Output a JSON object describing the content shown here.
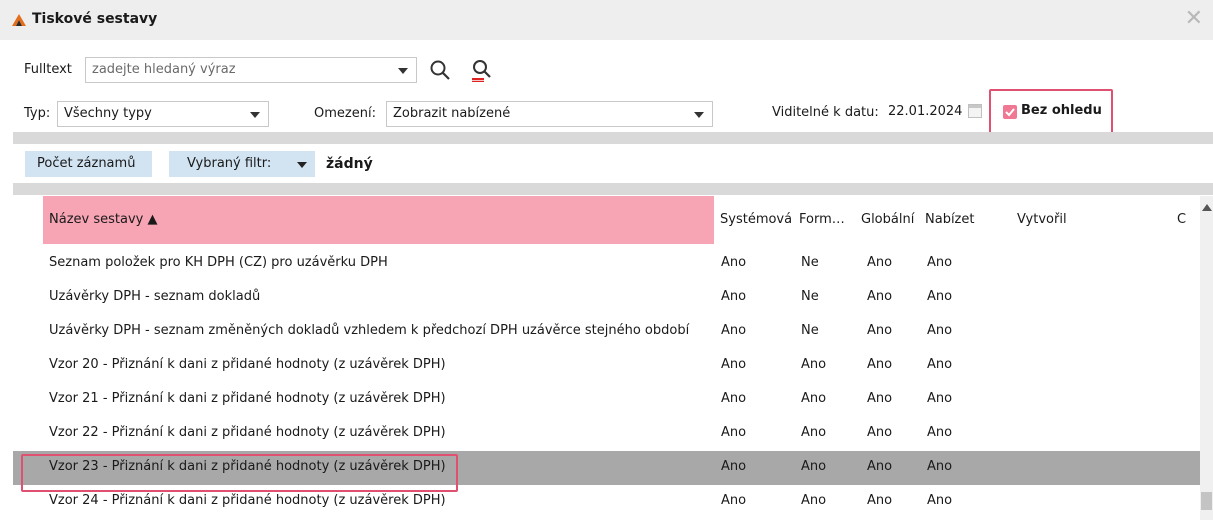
{
  "window": {
    "title": "Tiskové sestavy",
    "close_label": "✕"
  },
  "fulltext": {
    "label": "Fulltext",
    "placeholder": "zadejte hledaný výraz"
  },
  "filters": {
    "typ_label": "Typ:",
    "typ_value": "Všechny typy",
    "omezeni_label": "Omezení:",
    "omezeni_value": "Zobrazit nabízené",
    "date_label": "Viditelné k datu:",
    "date_value": "22.01.2024",
    "bez_ohledu_label": "Bez ohledu",
    "bez_ohledu_checked": true
  },
  "toolbar": {
    "count_label": "Počet záznamů",
    "filter_label": "Vybraný filtr:",
    "filter_value": "žádný"
  },
  "table": {
    "headers": [
      "Název sestavy ▲",
      "Systémová",
      "Form…",
      "Globální",
      "Nabízet",
      "Vytvořil",
      "C"
    ],
    "rows": [
      [
        "Seznam položek pro KH DPH (CZ) pro uzávěrku DPH",
        "Ano",
        "Ne",
        "Ano",
        "Ano"
      ],
      [
        "Uzávěrky DPH - seznam dokladů",
        "Ano",
        "Ne",
        "Ano",
        "Ano"
      ],
      [
        "Uzávěrky DPH - seznam změněných dokladů vzhledem k předchozí DPH uzávěrce stejného období",
        "Ano",
        "Ne",
        "Ano",
        "Ano"
      ],
      [
        "Vzor 20 - Přiznání k dani z přidané hodnoty (z uzávěrek DPH)",
        "Ano",
        "Ano",
        "Ano",
        "Ano"
      ],
      [
        "Vzor 21 - Přiznání k dani z přidané hodnoty (z uzávěrek DPH)",
        "Ano",
        "Ano",
        "Ano",
        "Ano"
      ],
      [
        "Vzor 22 - Přiznání k dani z přidané hodnoty (z uzávěrek DPH)",
        "Ano",
        "Ano",
        "Ano",
        "Ano"
      ],
      [
        "Vzor 23 - Přiznání k dani z přidané hodnoty (z uzávěrek DPH)",
        "Ano",
        "Ano",
        "Ano",
        "Ano"
      ],
      [
        "Vzor 24 - Přiznání k dani z přidané hodnoty (z uzávěrek DPH)",
        "Ano",
        "Ano",
        "Ano",
        "Ano"
      ]
    ],
    "selected_row": "Vzor 23 - Přiznání k dani z přidané hodnoty (z uzávěrek DPH)"
  },
  "icons": {
    "app": "app-logo-icon",
    "search": "search-icon",
    "clear_search": "clear-search-icon",
    "calendar": "calendar-icon",
    "checkbox": "checkbox-checked-icon",
    "dropdown": "chevron-down-icon",
    "sort": "sort-ascending-icon",
    "scroll_up": "scroll-up-icon"
  },
  "colors": {
    "highlight": "#e05070",
    "header_sorted": "#f7a4b4",
    "selected_row": "#a8a8a8",
    "pill": "#d2e3f2",
    "checkbox": "#f07892",
    "titlebar": "#eeeeee"
  }
}
